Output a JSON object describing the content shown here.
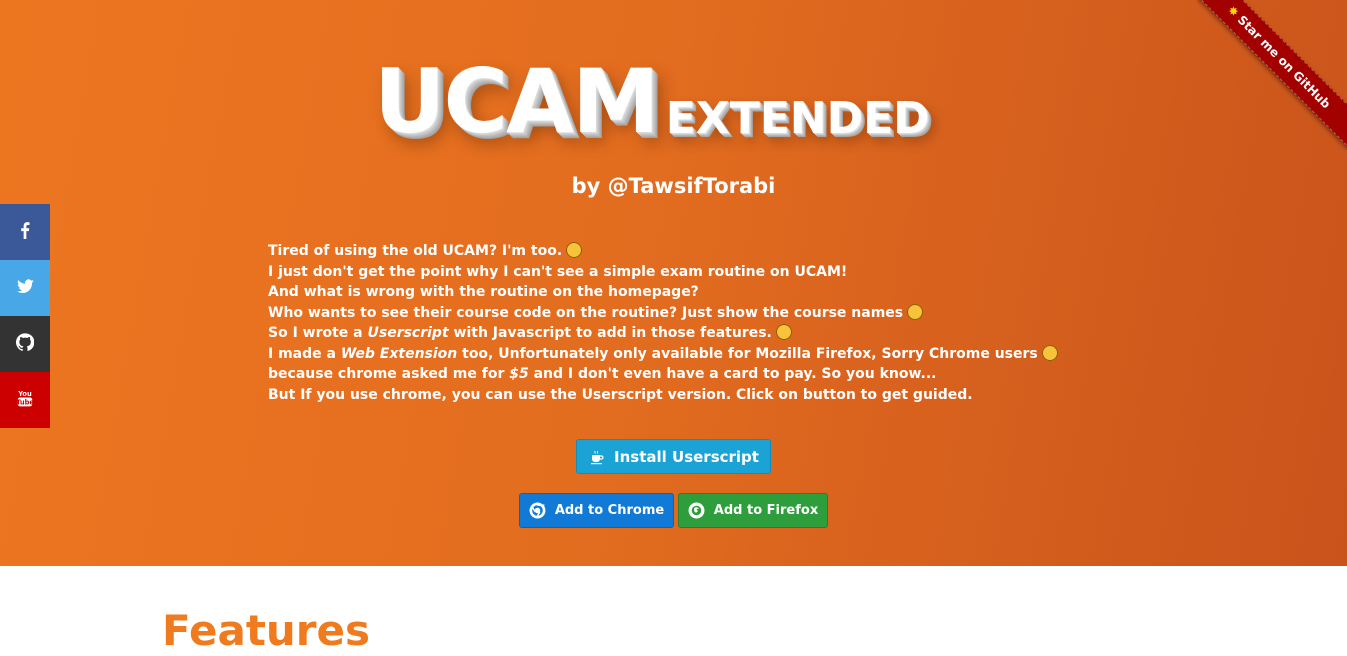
{
  "logo": {
    "main": "UCAM",
    "sub": "EXTENDED"
  },
  "byline": "by @TawsifTorabi",
  "intro": {
    "line1": "Tired of using the old UCAM? I'm too.",
    "line2": "I just don't get the point why I can't see a simple exam routine on UCAM!",
    "line3": "And what is wrong with the routine on the homepage?",
    "line4": "Who wants to see their course code on the routine? Just show the course names",
    "line5_pre": "So I wrote a ",
    "line5_em": "Userscript",
    "line5_post": " with Javascript to add in those features.",
    "line6_pre": "I made a ",
    "line6_em": "Web Extension",
    "line6_post": " too, Unfortunately only available for Mozilla Firefox, Sorry Chrome users",
    "line7_pre": "because chrome asked me for ",
    "line7_em": "$5",
    "line7_post": " and I don't even have a card to pay. So you know...",
    "line8": "But If you use chrome, you can use the Userscript version. Click on button to get guided."
  },
  "buttons": {
    "userscript": "Install Userscript",
    "chrome": "Add to Chrome",
    "firefox": "Add to Firefox"
  },
  "ribbon": "Star me on GitHub",
  "social": [
    "facebook-icon",
    "twitter-icon",
    "github-icon",
    "youtube-icon"
  ],
  "features_heading": "Features",
  "colors": {
    "hero_start": "#ec7620",
    "hero_end": "#c9531b",
    "userscript_btn": "#1ba3d6",
    "chrome_btn": "#117ad6",
    "firefox_btn": "#2e9e3c",
    "ribbon": "#a30000",
    "facebook": "#3b5998",
    "twitter": "#48a7e6",
    "github": "#333333",
    "youtube": "#cc0000"
  }
}
